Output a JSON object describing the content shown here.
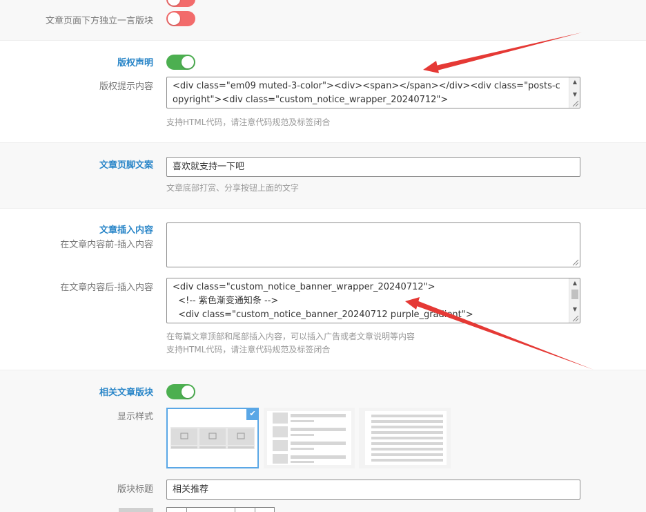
{
  "settings": {
    "standalone_quote_label": "文章页面下方独立一言版块",
    "copyright": {
      "title": "版权声明",
      "content_label": "版权提示内容",
      "content_value": "<div class=\"em09 muted-3-color\"><div><span></span></div><div class=\"posts-copyright\"><div class=\"custom_notice_wrapper_20240712\">",
      "hint": "支持HTML代码，请注意代码规范及标签闭合"
    },
    "footer_text": {
      "title": "文章页脚文案",
      "value": "喜欢就支持一下吧",
      "hint": "文章底部打赏、分享按钮上面的文字"
    },
    "insert_content": {
      "title": "文章插入内容",
      "before_label": "在文章内容前-插入内容",
      "before_value": "",
      "after_label": "在文章内容后-插入内容",
      "after_lines": [
        "<div class=\"custom_notice_banner_wrapper_20240712\">",
        "  <!-- 紫色渐变通知条 -->",
        "  <div class=\"custom_notice_banner_20240712 purple_gradient\">"
      ],
      "hint1": "在每篇文章顶部和尾部插入内容，可以插入广告或者文章说明等内容",
      "hint2": "支持HTML代码，请注意代码规范及标签闭合"
    },
    "related": {
      "title": "相关文章版块",
      "style_label": "显示样式",
      "block_title_label": "版块标题",
      "block_title_value": "相关推荐"
    }
  },
  "icons": {
    "scroll_up": "▲",
    "scroll_down": "▼",
    "check": "✔"
  },
  "colors": {
    "accent": "#2a86c8",
    "toggle_on": "#4caf50",
    "toggle_off": "#f26b6b",
    "arrow": "#e53935"
  }
}
